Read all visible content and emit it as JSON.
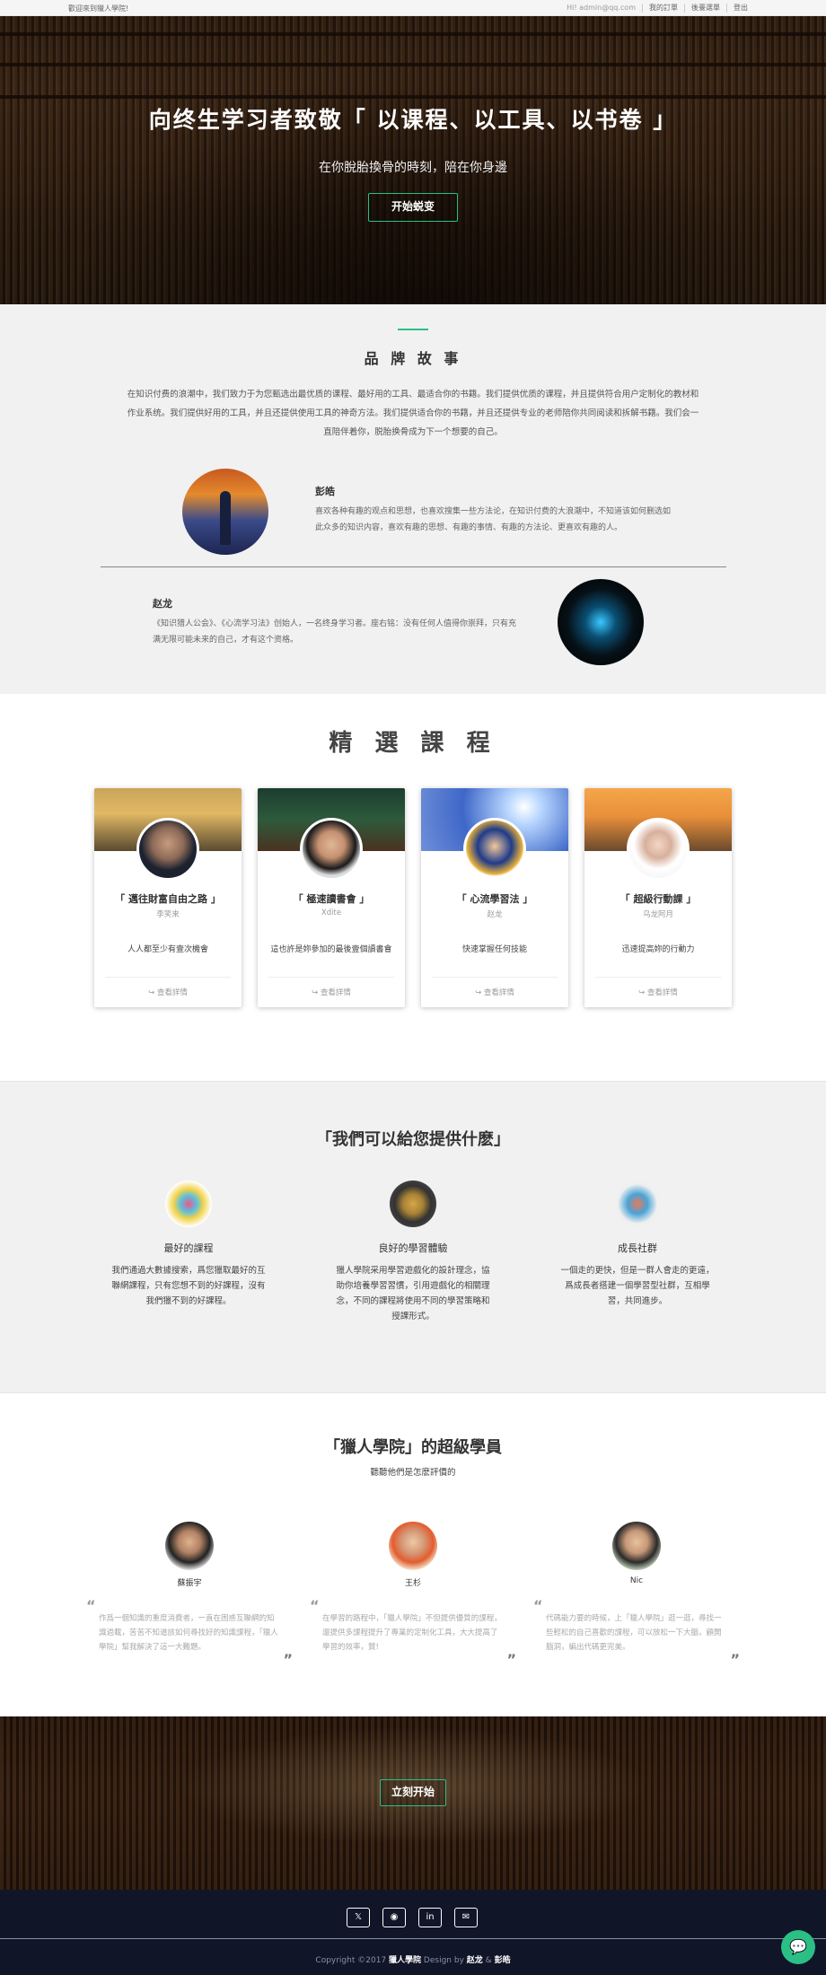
{
  "topbar": {
    "welcome": "歡迎來到獵人學院!",
    "greeting": "Hi! admin@qq.com",
    "orders": "我的訂單",
    "admin": "後臺選單",
    "logout": "登出"
  },
  "hero": {
    "title": "向终生学习者致敬「 以课程、以工具、以书卷 」",
    "subtitle": "在你脫胎換骨的時刻，陪在你身邊",
    "cta": "开始蜕变"
  },
  "brand": {
    "heading": "品 牌 故 事",
    "story": "在知识付费的浪潮中，我们致力于为您甄选出最优质的课程、最好用的工具、最适合你的书籍。我们提供优质的课程，并且提供符合用户定制化的教材和作业系统。我们提供好用的工具，并且还提供使用工具的神奇方法。我们提供适合你的书籍，并且还提供专业的老师陪你共同阅读和拆解书籍。我们会一直陪伴着你，脱胎换骨成为下一个想要的自己。",
    "people": [
      {
        "name": "彭皓",
        "desc": "喜欢各种有趣的观点和思想，也喜欢搜集一些方法论，在知识付费的大浪潮中，不知道该如何删选如此众多的知识内容，喜欢有趣的思想、有趣的事情、有趣的方法论、更喜欢有趣的人。"
      },
      {
        "name": "赵龙",
        "desc": "《知识猎人公会》、《心流学习法》创始人，一名终身学习者。座右铭：没有任何人值得你崇拜，只有充满无限可能未来的自己，才有这个资格。"
      }
    ]
  },
  "courses": {
    "heading": "精 選 課 程",
    "items": [
      {
        "title": "「 邁往財富自由之路 」",
        "author": "李笑来",
        "desc": "人人都至少有壹次機會",
        "more": "查看詳情"
      },
      {
        "title": "「 極速讀書會 」",
        "author": "Xdite",
        "desc": "這也許是妳參加的最後壹個讀書會",
        "more": "查看詳情"
      },
      {
        "title": "「 心流學習法 」",
        "author": "赵龙",
        "desc": "快速掌握任何技能",
        "more": "查看詳情"
      },
      {
        "title": "「 超級行動課 」",
        "author": "乌龙阿月",
        "desc": "迅速提高妳的行動力",
        "more": "查看詳情"
      }
    ]
  },
  "offer": {
    "heading": "「我們可以給您提供什麽」",
    "items": [
      {
        "title": "最好的課程",
        "desc": "我們通過大數據搜索，爲您獵取最好的互聯網課程，只有您想不到的好課程，沒有我們獵不到的好課程。"
      },
      {
        "title": "良好的學習體驗",
        "desc": "獵人學院采用學習遊戲化的設計理念，協助你培養學習習慣，引用遊戲化的相關理念，不同的課程將使用不同的學習策略和授課形式。"
      },
      {
        "title": "成長社群",
        "desc": "一個走的更快，但是一群人會走的更遠，爲成長者搭建一個學習型社群，互相學習，共同進步。"
      }
    ]
  },
  "students": {
    "heading": "「獵人學院」的超級學員",
    "subheading": "聽聽他們是怎麽評價的",
    "items": [
      {
        "name": "蘇振宇",
        "quote": "作爲一個知識的重度消費者，一直在困惑互聯網的知識過載，苦苦不知道該如何尋找好的知識課程，「獵人學院」幫我解決了這一大難題。"
      },
      {
        "name": "王杉",
        "quote": "在學習的路程中，「獵人學院」不但提供優質的課程，還提供多課程提升了專業的定制化工具，大大提高了學習的效率，贊!"
      },
      {
        "name": "Nic",
        "quote": "代碼能力要的時候，上「獵人學院」逛一逛，尋找一些輕松的自己喜歡的課程，可以放松一下大腦，顧開腦洞，編出代碼更完美。"
      }
    ]
  },
  "cta": {
    "label": "立刻开始"
  },
  "footer": {
    "social": [
      {
        "icon": "twitter-icon",
        "glyph": "𝕏"
      },
      {
        "icon": "github-icon",
        "glyph": "◉"
      },
      {
        "icon": "linkedin-icon",
        "glyph": "in"
      },
      {
        "icon": "email-icon",
        "glyph": "✉"
      }
    ],
    "copyright_prefix": "Copyright ©2017",
    "brand": "獵人學院",
    "design_by": "Design by",
    "author1": "赵龙",
    "amp": "&",
    "author2": "彭皓"
  },
  "colors": {
    "accent": "#2bbf85",
    "footer": "#101528",
    "section_gray": "#f1f1f1"
  }
}
